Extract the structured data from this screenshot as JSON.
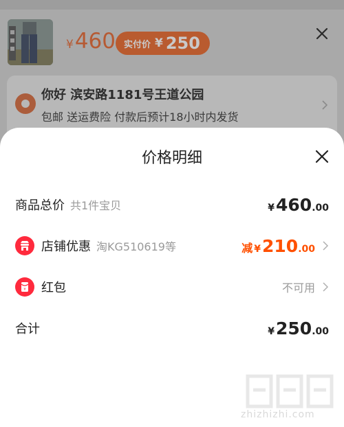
{
  "background": {
    "top_tabs": [
      "",
      "",
      ""
    ],
    "product": {
      "price_currency": "¥",
      "price_value": "460",
      "pay_label": "实付价",
      "pay_currency": "¥",
      "pay_value": "250"
    },
    "address": {
      "title": "你好  滨安路1181号王道公园",
      "subtitle": "包邮  送运费险  付款后预计18小时内发货"
    }
  },
  "modal": {
    "title": "价格明细",
    "rows": [
      {
        "label": "商品总价",
        "sub": "共1件宝贝",
        "currency": "¥",
        "int": "460",
        "dec": ".00"
      },
      {
        "label": "店铺优惠",
        "sub": "淘KG510619等",
        "prefix": "减",
        "currency": "¥",
        "int": "210",
        "dec": ".00"
      },
      {
        "label": "红包",
        "status": "不可用"
      },
      {
        "label": "合计",
        "currency": "¥",
        "int": "250",
        "dec": ".00"
      }
    ]
  },
  "watermark": {
    "text": "zhizhizhi.com"
  },
  "colors": {
    "accent": "#ff5000",
    "red_icon": "#ff2a3d"
  }
}
